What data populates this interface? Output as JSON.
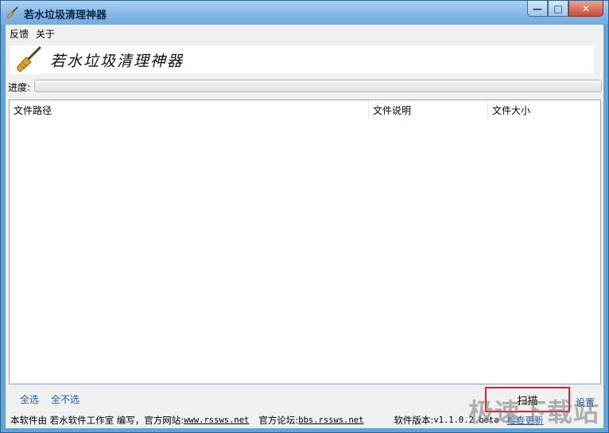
{
  "window": {
    "title": "若水垃圾清理神器",
    "buttons": {
      "minimize": "—",
      "maximize": "□",
      "close": "✕"
    }
  },
  "menu": [
    {
      "label": "反馈"
    },
    {
      "label": "关于"
    }
  ],
  "banner": {
    "title": "若水垃圾清理神器"
  },
  "progress": {
    "label": "进度:",
    "value_percent": 0
  },
  "list": {
    "columns": [
      "文件路径",
      "文件说明",
      "文件大小"
    ],
    "rows": []
  },
  "actions": {
    "select_all": "全选",
    "select_none": "全不选",
    "scan": "扫描",
    "settings": "设置"
  },
  "status": {
    "made_by": "本软件由 若水软件工作室 编写，官方网站:",
    "website": "www.rssws.net",
    "forum_label": "官方论坛:",
    "forum": "bbs.rssws.net",
    "version_label": "软件版本:",
    "version": "v1.1.0.2 beta",
    "check_update": "检查更新"
  },
  "watermark": "极速下载站",
  "colors": {
    "accent": "#1a5fb4",
    "highlight_border": "#e0202a",
    "title_bg": "#7fb6e6"
  },
  "icons": {
    "app": "broom-icon"
  }
}
